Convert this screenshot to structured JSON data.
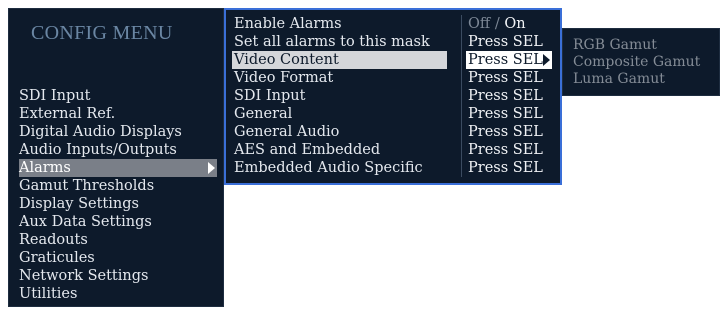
{
  "config_title": "CONFIG MENU",
  "main_menu": {
    "items": [
      {
        "label": "SDI Input",
        "selected": false
      },
      {
        "label": "External Ref.",
        "selected": false
      },
      {
        "label": "Digital Audio Displays",
        "selected": false
      },
      {
        "label": "Audio Inputs/Outputs",
        "selected": false
      },
      {
        "label": "Alarms",
        "selected": true
      },
      {
        "label": "Gamut Thresholds",
        "selected": false
      },
      {
        "label": "Display Settings",
        "selected": false
      },
      {
        "label": "Aux Data Settings",
        "selected": false
      },
      {
        "label": "Readouts",
        "selected": false
      },
      {
        "label": "Graticules",
        "selected": false
      },
      {
        "label": "Network Settings",
        "selected": false
      },
      {
        "label": "Utilities",
        "selected": false
      }
    ]
  },
  "alarms_submenu": {
    "rows": [
      {
        "label": "Enable Alarms",
        "value_off": "Off",
        "value_sep": "/",
        "value_on": "On"
      },
      {
        "label": "Set all alarms to this mask",
        "value": "Press SEL"
      },
      {
        "label": "Video Content",
        "value": "Press SEL",
        "selected": true
      },
      {
        "label": "Video Format",
        "value": "Press SEL"
      },
      {
        "label": "SDI Input",
        "value": "Press SEL"
      },
      {
        "label": "General",
        "value": "Press SEL"
      },
      {
        "label": "General Audio",
        "value": "Press SEL"
      },
      {
        "label": "AES and Embedded",
        "value": "Press SEL"
      },
      {
        "label": "Embedded Audio Specific",
        "value": "Press SEL"
      }
    ]
  },
  "video_content_submenu": {
    "items": [
      "RGB Gamut",
      "Composite Gamut",
      "Luma Gamut"
    ]
  },
  "colors": {
    "panel_bg": "#0d1a2b",
    "highlight_border": "#3a6fd8",
    "selection_gray": "#7a7f88",
    "title_blue": "#6a86a3"
  }
}
